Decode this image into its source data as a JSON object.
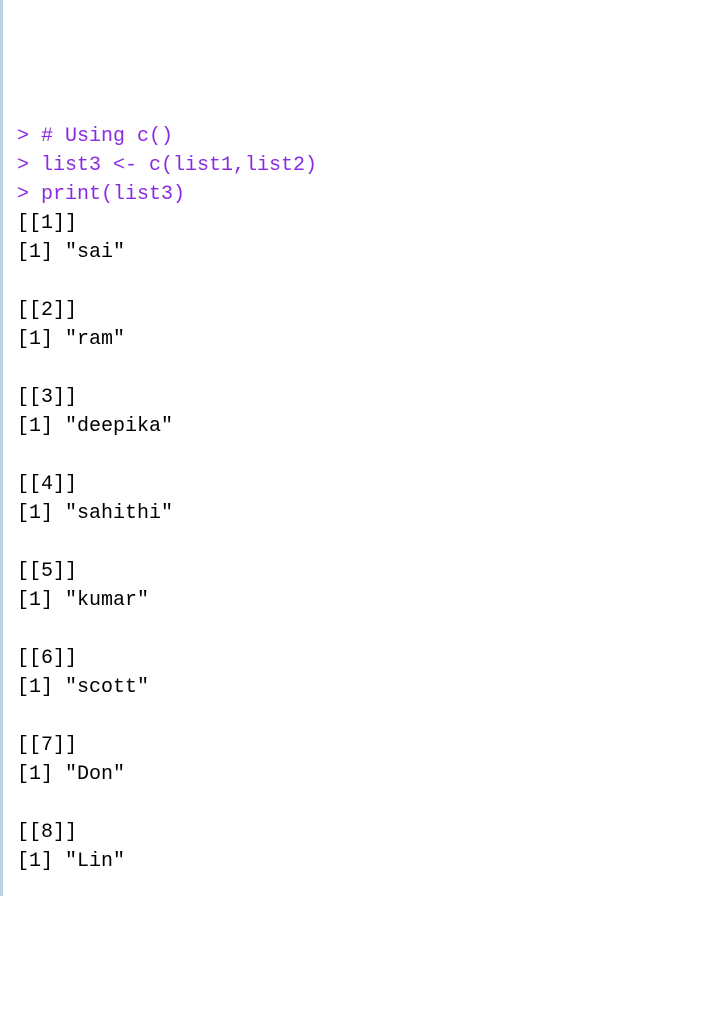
{
  "console": {
    "lines": [
      {
        "type": "input",
        "prompt": "> ",
        "text": "# Using c()"
      },
      {
        "type": "input",
        "prompt": "> ",
        "text": "list3 <- c(list1,list2)"
      },
      {
        "type": "input",
        "prompt": "> ",
        "text": "print(list3)"
      },
      {
        "type": "output",
        "text": "[[1]]"
      },
      {
        "type": "output",
        "text": "[1] \"sai\""
      },
      {
        "type": "blank",
        "text": ""
      },
      {
        "type": "output",
        "text": "[[2]]"
      },
      {
        "type": "output",
        "text": "[1] \"ram\""
      },
      {
        "type": "blank",
        "text": ""
      },
      {
        "type": "output",
        "text": "[[3]]"
      },
      {
        "type": "output",
        "text": "[1] \"deepika\""
      },
      {
        "type": "blank",
        "text": ""
      },
      {
        "type": "output",
        "text": "[[4]]"
      },
      {
        "type": "output",
        "text": "[1] \"sahithi\""
      },
      {
        "type": "blank",
        "text": ""
      },
      {
        "type": "output",
        "text": "[[5]]"
      },
      {
        "type": "output",
        "text": "[1] \"kumar\""
      },
      {
        "type": "blank",
        "text": ""
      },
      {
        "type": "output",
        "text": "[[6]]"
      },
      {
        "type": "output",
        "text": "[1] \"scott\""
      },
      {
        "type": "blank",
        "text": ""
      },
      {
        "type": "output",
        "text": "[[7]]"
      },
      {
        "type": "output",
        "text": "[1] \"Don\""
      },
      {
        "type": "blank",
        "text": ""
      },
      {
        "type": "output",
        "text": "[[8]]"
      },
      {
        "type": "output",
        "text": "[1] \"Lin\""
      }
    ]
  }
}
